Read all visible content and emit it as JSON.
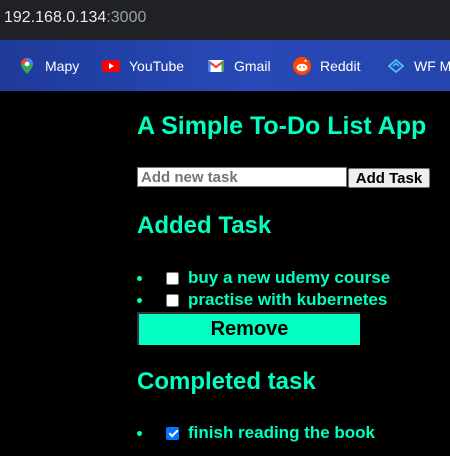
{
  "browser": {
    "url_host": "192.168.0.134",
    "url_port": ":3000"
  },
  "bookmarks": [
    {
      "label": "Mapy",
      "icon": "map-pin-icon"
    },
    {
      "label": "YouTube",
      "icon": "youtube-icon"
    },
    {
      "label": "Gmail",
      "icon": "gmail-icon"
    },
    {
      "label": "Reddit",
      "icon": "reddit-icon"
    },
    {
      "label": "WF M",
      "icon": "wf-icon"
    }
  ],
  "app": {
    "title": "A Simple To-Do List App",
    "input_placeholder": "Add new task",
    "input_value": "",
    "add_button": "Add Task",
    "added_heading": "Added Task",
    "added_tasks": [
      {
        "label": "buy a new udemy course",
        "checked": false
      },
      {
        "label": "practise with kubernetes",
        "checked": false
      }
    ],
    "remove_button": "Remove",
    "completed_heading": "Completed task",
    "completed_tasks": [
      {
        "label": "finish reading the book",
        "checked": true
      }
    ]
  },
  "colors": {
    "accent": "#00ffc0",
    "background": "#000000",
    "checkbox_checked": "#0075ff"
  }
}
